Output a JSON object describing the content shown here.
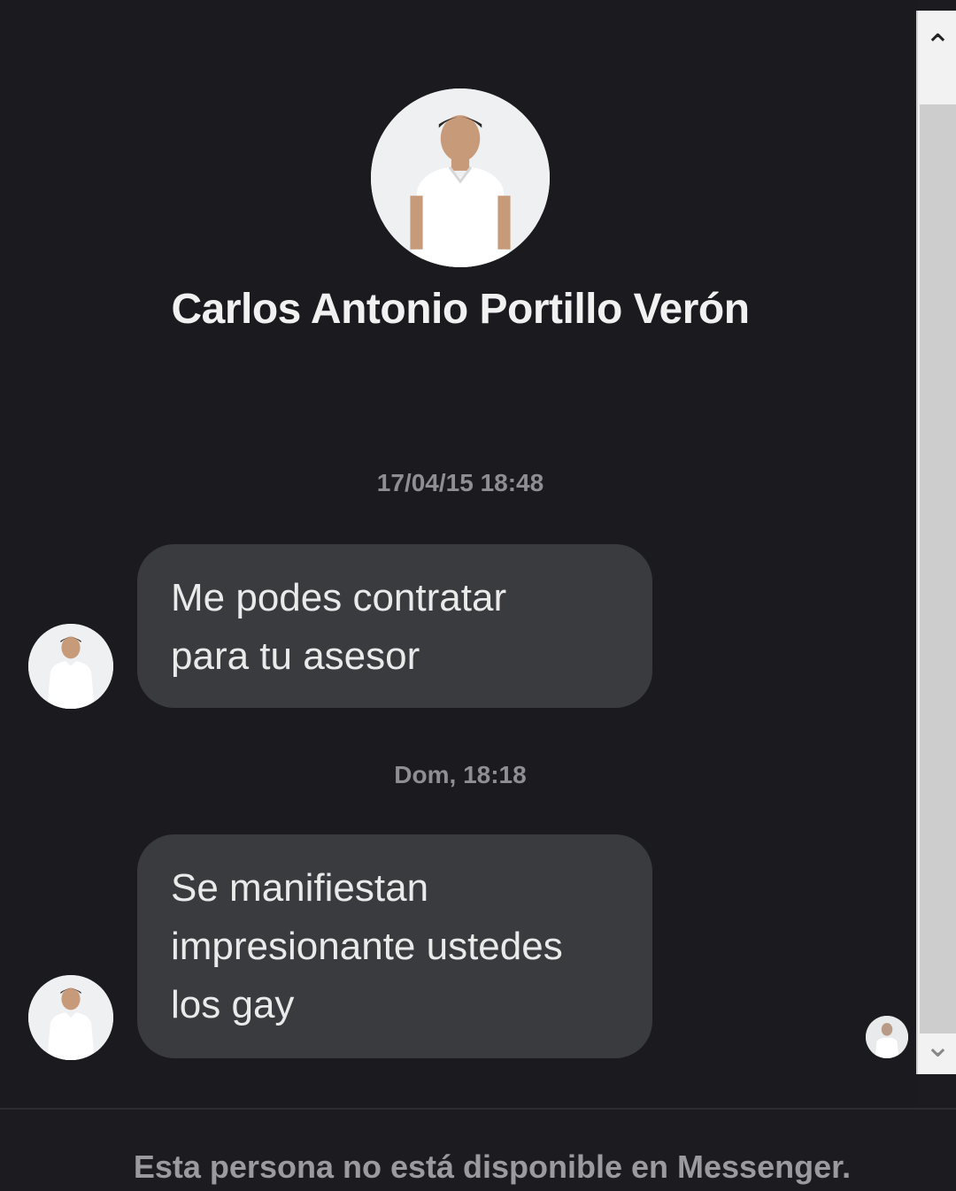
{
  "contact": {
    "name": "Carlos Antonio Portillo Verón",
    "avatar_icon": "profile-photo"
  },
  "conversation": [
    {
      "timestamp": "17/04/15 18:48",
      "message": "Me podes contratar\npara tu asesor"
    },
    {
      "timestamp": "Dom, 18:18",
      "message": "Se manifiestan\nimpresionante ustedes\nlos gay"
    }
  ],
  "scrollbar": {
    "up_icon": "chevron-up-icon",
    "down_icon": "chevron-down-icon"
  },
  "footer": {
    "status_text": "Esta persona no está disponible en Messenger."
  },
  "colors": {
    "background": "#1b1b1f",
    "bubble": "#3a3b3f",
    "text": "#eaeaea",
    "muted": "#8e8e93"
  }
}
